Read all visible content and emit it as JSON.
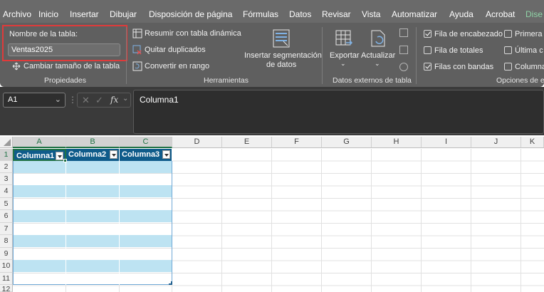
{
  "ribbon_tabs": [
    "Archivo",
    "Inicio",
    "Insertar",
    "Dibujar",
    "Disposición de página",
    "Fórmulas",
    "Datos",
    "Revisar",
    "Vista",
    "Automatizar",
    "Ayuda",
    "Acrobat",
    "Dise"
  ],
  "properties": {
    "table_name_label": "Nombre de la tabla:",
    "table_name_value": "Ventas2025",
    "resize_label": "Cambiar tamaño de la tabla",
    "group_label": "Propiedades"
  },
  "tools": {
    "pivot_label": "Resumir con tabla dinámica",
    "dedupe_label": "Quitar duplicados",
    "convert_label": "Convertir en rango",
    "slicer_label_line1": "Insertar segmentación",
    "slicer_label_line2": "de datos",
    "group_label": "Herramientas"
  },
  "external": {
    "export_label": "Exportar",
    "refresh_label": "Actualizar",
    "group_label": "Datos externos de tabla"
  },
  "style_options": {
    "header_row": "Fila de encabezado",
    "total_row": "Fila de totales",
    "banded_rows": "Filas con bandas",
    "first_col": "Primera c",
    "last_col": "Última c",
    "banded_cols": "Columna",
    "group_label": "Opciones de es",
    "header_row_checked": true,
    "total_row_checked": false,
    "banded_rows_checked": true
  },
  "formula_bar": {
    "name_box": "A1",
    "content": "Columna1",
    "fx": "fx"
  },
  "columns": [
    "A",
    "B",
    "C",
    "D",
    "E",
    "F",
    "G",
    "H",
    "I",
    "J",
    "K"
  ],
  "rows": [
    "1",
    "2",
    "3",
    "4",
    "5",
    "6",
    "7",
    "8",
    "9",
    "10",
    "11",
    "12"
  ],
  "table_headers": [
    "Columna1",
    "Columna2",
    "Columna3"
  ],
  "colors": {
    "ribbon": "#5f5f5f",
    "table_header": "#0f5b8a",
    "band": "#bde3f2",
    "accent": "#217346",
    "highlight_box": "#e03a3a"
  }
}
